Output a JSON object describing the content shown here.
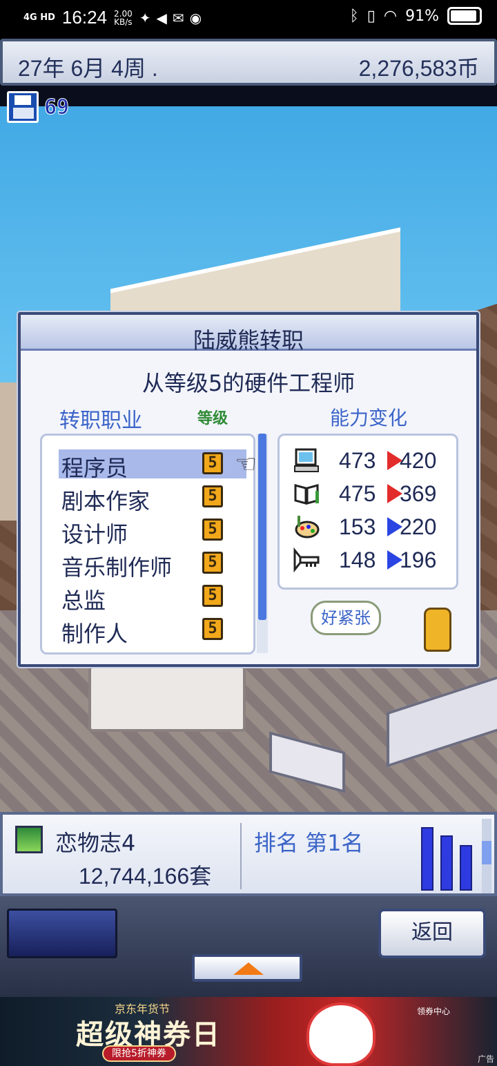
{
  "status_bar": {
    "network": "4G HD",
    "time": "16:24",
    "speed_value": "2.00",
    "speed_unit": "KB/s",
    "battery": "91%"
  },
  "top_bar": {
    "date": "27年 6月 4周",
    "date_marker": ".",
    "money": "2,276,583币"
  },
  "save": {
    "count": "69"
  },
  "dialog": {
    "title": "陆威熊转职",
    "subtitle": "从等级5的硬件工程师",
    "label_job": "转职职业",
    "label_level": "等级",
    "label_ability": "能力变化",
    "jobs": [
      {
        "name": "程序员",
        "level": "5",
        "selected": true
      },
      {
        "name": "剧本作家",
        "level": "5"
      },
      {
        "name": "设计师",
        "level": "5"
      },
      {
        "name": "音乐制作师",
        "level": "5"
      },
      {
        "name": "总监",
        "level": "5"
      },
      {
        "name": "制作人",
        "level": "5"
      }
    ],
    "abilities": [
      {
        "icon": "computer-icon",
        "old": "473",
        "new": "420",
        "direction": "down",
        "arrow_color": "#e22b2b"
      },
      {
        "icon": "book-icon",
        "old": "475",
        "new": "369",
        "direction": "down",
        "arrow_color": "#e22b2b"
      },
      {
        "icon": "palette-icon",
        "old": "153",
        "new": "220",
        "direction": "up",
        "arrow_color": "#2b45e2"
      },
      {
        "icon": "trumpet-icon",
        "old": "148",
        "new": "196",
        "direction": "up",
        "arrow_color": "#2b45e2"
      }
    ],
    "speech": "好紧张"
  },
  "sales": {
    "game_name": "恋物志4",
    "units": "12,744,166套",
    "rank": "排名 第1名"
  },
  "controls": {
    "back_label": "返回"
  },
  "ad": {
    "top_text": "京东年货节",
    "main_text": "超级神券日",
    "pill_text": "限抢5折神券",
    "right_text": "领券中心",
    "corner_text": "广告"
  }
}
